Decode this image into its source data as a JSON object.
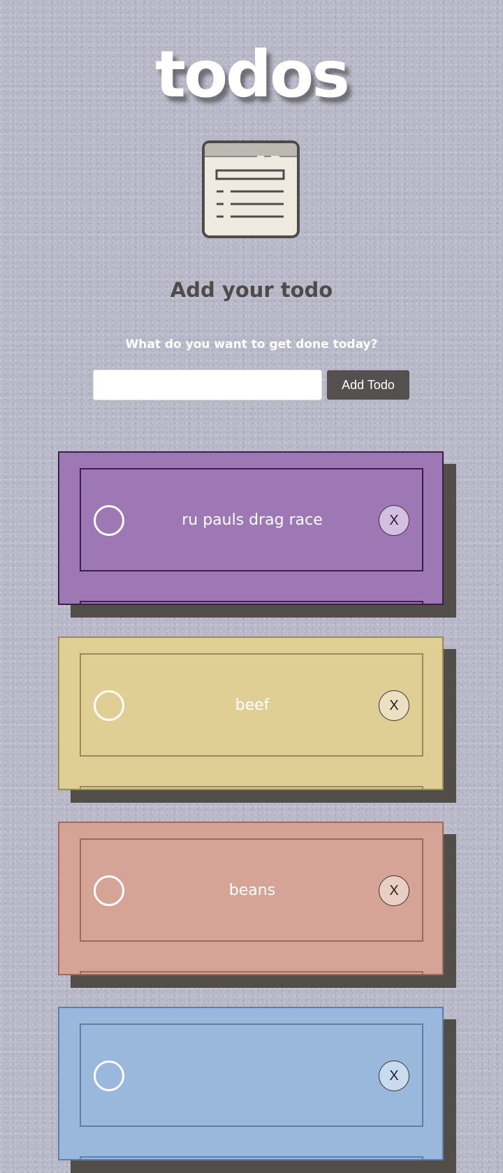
{
  "app": {
    "title": "todos",
    "subtitle": "Add your todo",
    "prompt": "What do you want to get done today?"
  },
  "form": {
    "input_value": "",
    "input_placeholder": "",
    "add_button_label": "Add Todo"
  },
  "colors": {
    "background": "#b9b8c9",
    "button_bg": "#545050",
    "shadow": "#514d48"
  },
  "todos": [
    {
      "text": "ru pauls drag race",
      "delete_label": "X",
      "completed": false,
      "card_color": "#9e78b4",
      "border_color": "#3b1f4a",
      "delete_bg": "#d4bfe2"
    },
    {
      "text": "beef",
      "delete_label": "X",
      "completed": false,
      "card_color": "#dfcf95",
      "border_color": "#9c8a5a",
      "delete_bg": "#ecdfc2"
    },
    {
      "text": "beans",
      "delete_label": "X",
      "completed": false,
      "card_color": "#d5a497",
      "border_color": "#9a6a5c",
      "delete_bg": "#e9cfc3"
    },
    {
      "text": "",
      "delete_label": "X",
      "completed": false,
      "card_color": "#9ab7dc",
      "border_color": "#5e7ea8",
      "delete_bg": "#c9dbef"
    }
  ]
}
